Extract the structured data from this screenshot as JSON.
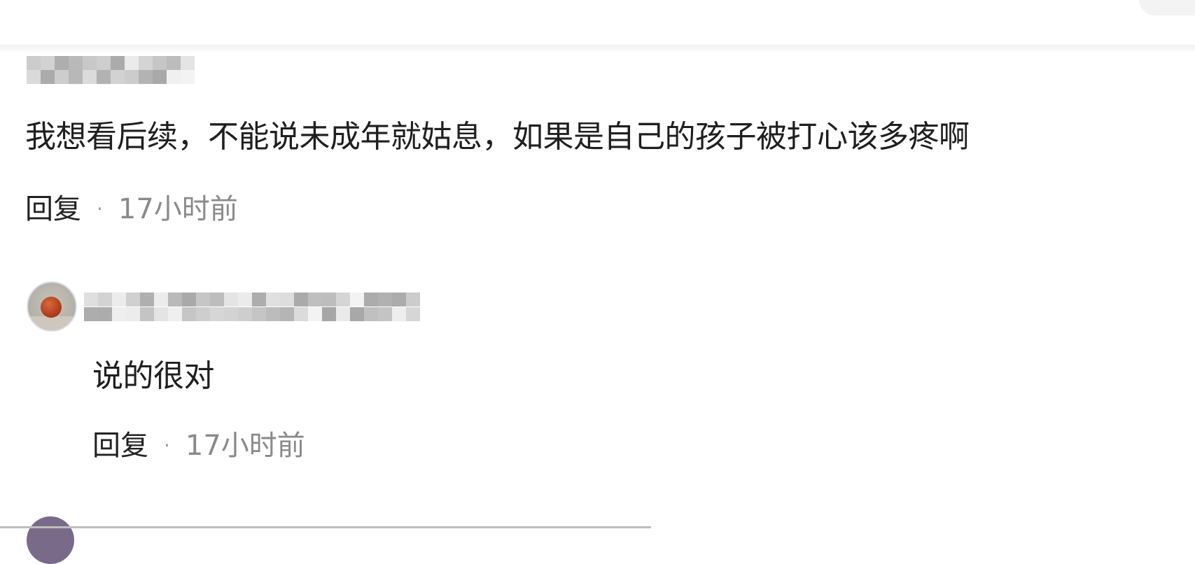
{
  "comments": [
    {
      "author_display": "",
      "text": "我想看后续，不能说未成年就姑息，如果是自己的孩子被打心该多疼啊",
      "reply_label": "回复",
      "separator": "·",
      "time": "17小时前"
    },
    {
      "author_display": "",
      "avatar_icon": "basketball-avatar-icon",
      "text": "说的很对",
      "reply_label": "回复",
      "separator": "·",
      "time": "17小时前"
    }
  ],
  "colors": {
    "text_primary": "#1f1f1f",
    "text_secondary": "#8a8a8a",
    "separator": "#999999",
    "background": "#ffffff"
  }
}
